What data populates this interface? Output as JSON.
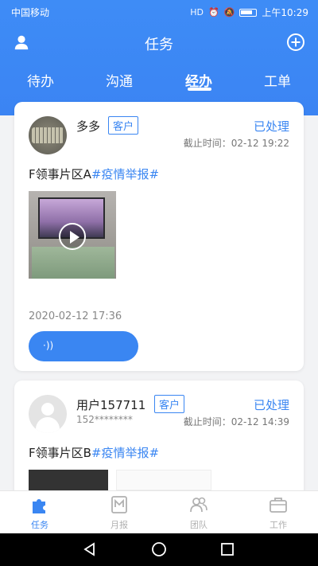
{
  "status_bar": {
    "carrier": "中国移动",
    "time": "上午10:29"
  },
  "header": {
    "title": "任务",
    "tabs": [
      "待办",
      "沟通",
      "经办",
      "工单"
    ],
    "active_tab": "经办"
  },
  "cards": [
    {
      "name": "多多",
      "badge": "客户",
      "status": "已处理",
      "deadline": "截止时间：02-12 19:22",
      "area": "F领事片区A",
      "tag": "#疫情举报#",
      "time": "2020-02-12 17:36"
    },
    {
      "name": "用户157711",
      "badge": "客户",
      "phone": "152********",
      "status": "已处理",
      "deadline": "截止时间：02-12 14:39",
      "area": "F领事片区B",
      "tag": "#疫情举报#"
    }
  ],
  "bottom_nav": [
    {
      "label": "任务"
    },
    {
      "label": "月报"
    },
    {
      "label": "团队"
    },
    {
      "label": "工作"
    }
  ],
  "colors": {
    "primary": "#3a86f2",
    "header": "#3e8cf6",
    "inactive": "#b0b0b0"
  }
}
